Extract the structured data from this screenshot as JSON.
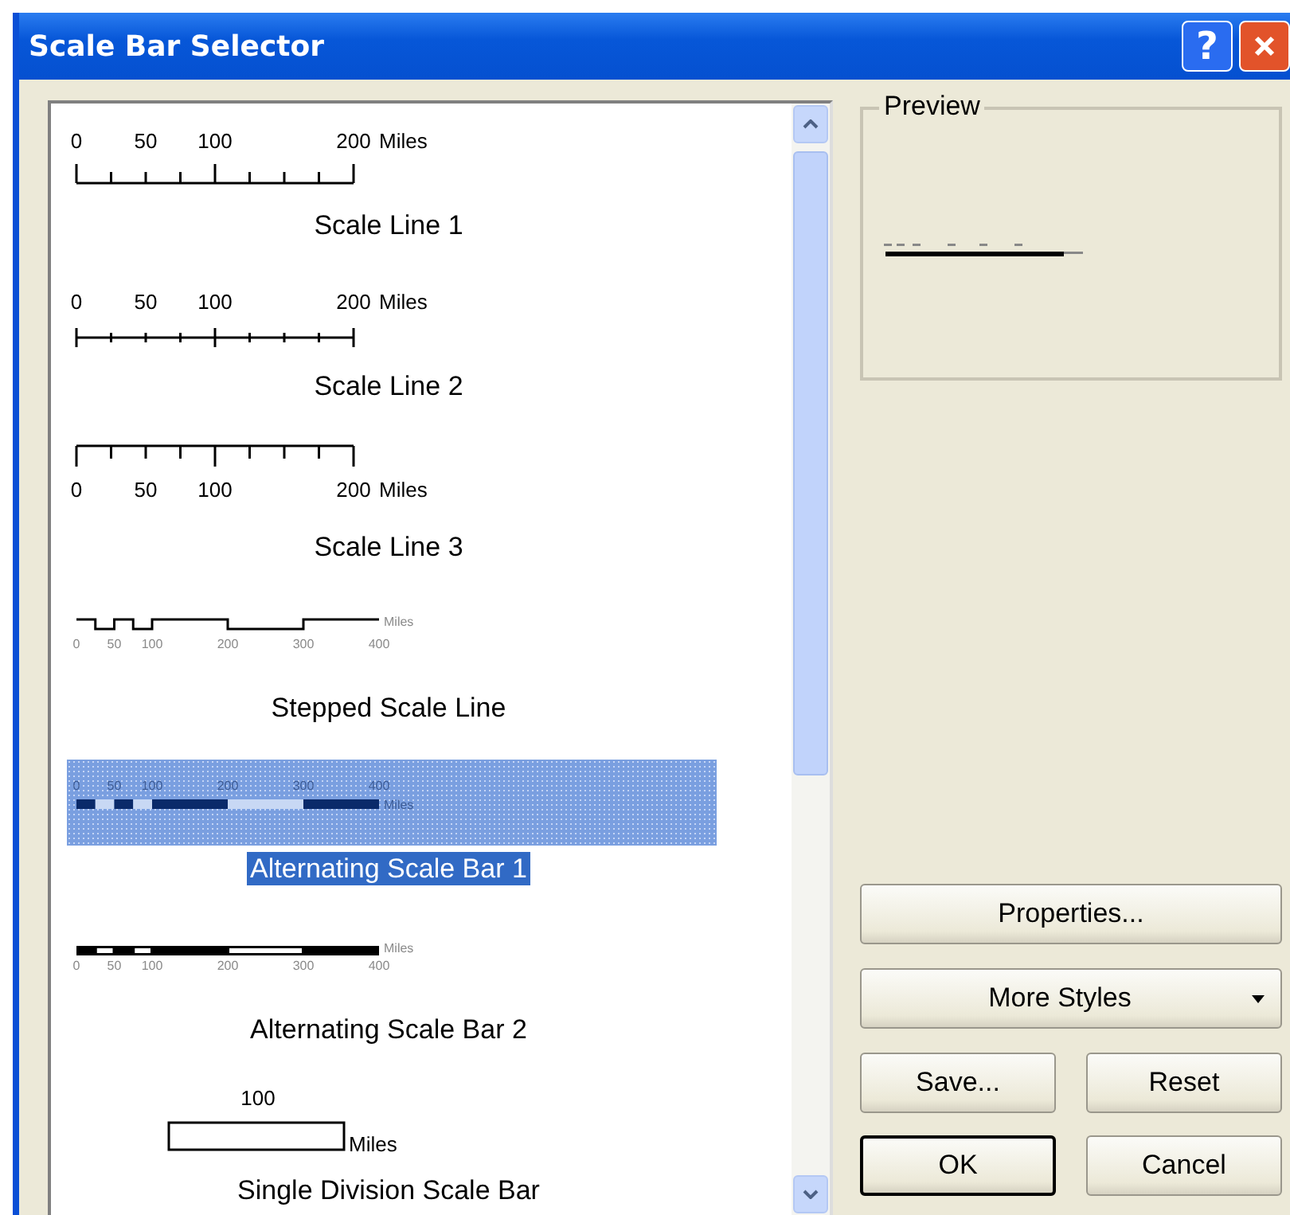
{
  "window": {
    "title": "Scale Bar Selector",
    "help_button": "?"
  },
  "styles": [
    {
      "name": "Scale Line 1",
      "kind": "scale_line_1",
      "selected": false,
      "labels": [
        "0",
        "50",
        "100",
        "200"
      ],
      "unit": "Miles"
    },
    {
      "name": "Scale Line 2",
      "kind": "scale_line_2",
      "selected": false,
      "labels": [
        "0",
        "50",
        "100",
        "200"
      ],
      "unit": "Miles"
    },
    {
      "name": "Scale Line 3",
      "kind": "scale_line_3",
      "selected": false,
      "labels": [
        "0",
        "50",
        "100",
        "200"
      ],
      "unit": "Miles"
    },
    {
      "name": "Stepped Scale Line",
      "kind": "stepped",
      "selected": false,
      "labels": [
        "0",
        "50",
        "100",
        "200",
        "300",
        "400"
      ],
      "unit": "Miles"
    },
    {
      "name": "Alternating Scale Bar 1",
      "kind": "alternating_1",
      "selected": true,
      "labels": [
        "0",
        "50",
        "100",
        "200",
        "300",
        "400"
      ],
      "unit": "Miles"
    },
    {
      "name": "Alternating Scale Bar 2",
      "kind": "alternating_2",
      "selected": false,
      "labels": [
        "0",
        "50",
        "100",
        "200",
        "300",
        "400"
      ],
      "unit": "Miles"
    },
    {
      "name": "Single Division Scale Bar",
      "kind": "single_division",
      "selected": false,
      "labels": [
        "100"
      ],
      "unit": "Miles"
    }
  ],
  "preview": {
    "label": "Preview"
  },
  "buttons": {
    "properties": "Properties...",
    "more_styles": "More Styles",
    "save": "Save...",
    "reset": "Reset",
    "ok": {
      "label": "OK",
      "default": true
    },
    "cancel": "Cancel"
  }
}
